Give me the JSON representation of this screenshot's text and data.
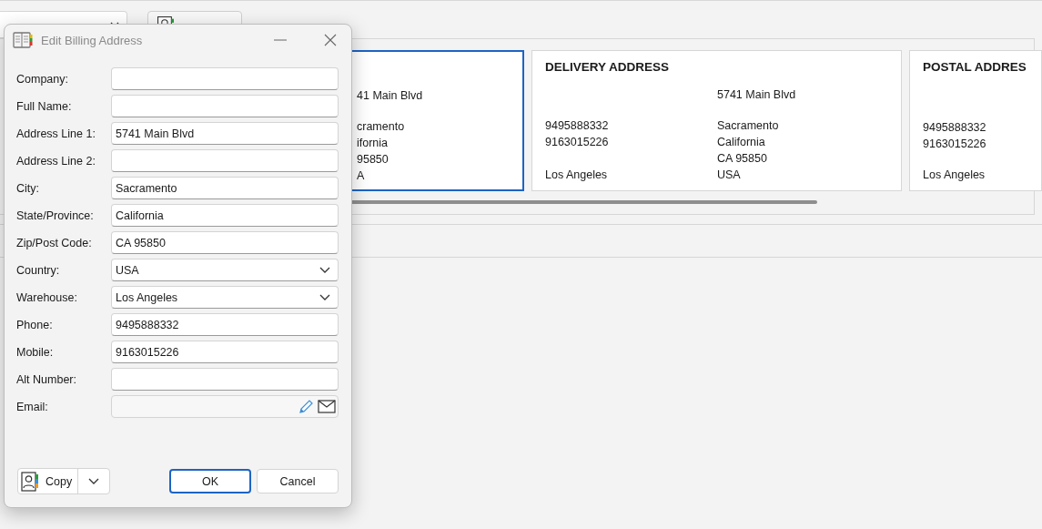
{
  "cards": [
    {
      "selected": true,
      "groups": [
        [
          {
            "column_2": "41 Main Blvd"
          }
        ],
        [
          {
            "column_2": "cramento"
          },
          {
            "column_2": "ifornia"
          },
          {
            "column_2": "95850"
          },
          {
            "column_2": "A"
          }
        ]
      ]
    },
    {
      "selected": false,
      "title": "DELIVERY ADDRESS",
      "groups": [
        [
          {
            "column_2": "5741 Main Blvd"
          }
        ],
        [
          {
            "column_1": "9495888332",
            "column_2": "Sacramento"
          },
          {
            "column_1": "9163015226",
            "column_2": "California"
          },
          {
            "column_2": "CA 95850"
          },
          {
            "column_1": "Los Angeles",
            "column_2": "USA"
          }
        ]
      ]
    },
    {
      "selected": false,
      "title": "POSTAL ADDRES",
      "groups": [
        [
          {
            "column_1": "9495888332"
          },
          {
            "column_1": "9163015226"
          }
        ],
        [
          {
            "column_1": "Los Angeles"
          }
        ]
      ]
    }
  ],
  "dialog": {
    "title": "Edit Billing Address",
    "fields": [
      {
        "label": "Company:",
        "kind": "text",
        "disabled": false
      },
      {
        "label": "Full Name:",
        "kind": "text",
        "disabled": false
      },
      {
        "label": "Address Line 1:",
        "kind": "text",
        "value": "5741 Main Blvd",
        "disabled": false
      },
      {
        "label": "Address Line 2:",
        "kind": "text",
        "disabled": false
      },
      {
        "label": "City:",
        "kind": "text",
        "value": "Sacramento",
        "disabled": false
      },
      {
        "label": "State/Province:",
        "kind": "text",
        "value": "California",
        "disabled": false
      },
      {
        "label": "Zip/Post Code:",
        "kind": "text",
        "value": "CA 95850",
        "disabled": false
      },
      {
        "label": "Country:",
        "kind": "dropdown",
        "value": "USA",
        "disabled": false
      },
      {
        "label": "Warehouse:",
        "kind": "dropdown",
        "value": "Los Angeles",
        "disabled": false
      },
      {
        "label": "Phone:",
        "kind": "text",
        "value": "9495888332",
        "disabled": false
      },
      {
        "label": "Mobile:",
        "kind": "text",
        "value": "9163015226",
        "disabled": false
      },
      {
        "label": "Alt Number:",
        "kind": "text",
        "disabled": false
      },
      {
        "label": "Email:",
        "kind": "email",
        "disabled": true
      }
    ],
    "copy_button": {
      "label": "Copy"
    },
    "buttons": [
      {
        "label": "OK",
        "default": true
      },
      {
        "label": "Cancel",
        "default": false
      }
    ]
  }
}
